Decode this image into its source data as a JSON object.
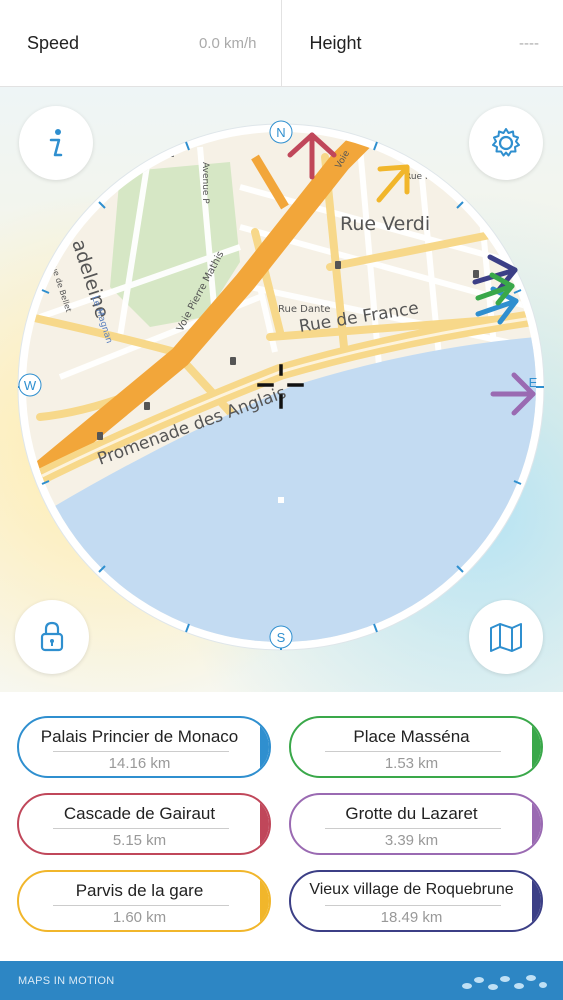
{
  "header": {
    "speed_label": "Speed",
    "speed_value": "0.0 km/h",
    "height_label": "Height",
    "height_value": "----"
  },
  "compass": {
    "north": "N",
    "east": "E",
    "south": "S",
    "west": "W"
  },
  "map_labels": {
    "rue_verdi": "Rue Verdi",
    "rue_de_france": "Rue de France",
    "promenade": "Promenade des Anglais",
    "madeleine": "adeleine",
    "voie_pierre_mathis": "Voie Pierre Mathis",
    "rue_dante": "Rue Dante",
    "rue_rossini": "Rue Rossini",
    "avenue": "Avenue P",
    "voie": "Voie",
    "magnan": "Le Magnan",
    "rue_de_bellet": "Rue de Bellet"
  },
  "buttons": {
    "info_icon": "info-icon",
    "settings_icon": "gear-icon",
    "lock_icon": "lock-icon",
    "map_icon": "folded-map-icon"
  },
  "destinations": [
    {
      "name": "Palais Princier de Monaco",
      "distance": "14.16 km",
      "color": "#2f8fcf"
    },
    {
      "name": "Place Masséna",
      "distance": "1.53 km",
      "color": "#3aa84a"
    },
    {
      "name": "Cascade de Gairaut",
      "distance": "5.15 km",
      "color": "#c0475a"
    },
    {
      "name": "Grotte du Lazaret",
      "distance": "3.39 km",
      "color": "#9a6ab2"
    },
    {
      "name": "Parvis de la gare",
      "distance": "1.60 km",
      "color": "#f1b62b"
    },
    {
      "name": "Vieux village de Roquebrune",
      "distance": "18.49 km",
      "color": "#3c3f86"
    }
  ],
  "footer": {
    "brand": "MAPS IN MOTION"
  },
  "colors": {
    "footer_bg": "#2d86c4",
    "sea": "#c3dbf2",
    "main_road": "#f2a63a",
    "pointer_red": "#c0475a",
    "pointer_yellow": "#f1b62b",
    "pointer_navy": "#3c3f86",
    "pointer_blue": "#2f8fcf",
    "pointer_purple": "#9a6ab2",
    "pointer_green": "#3aa84a"
  }
}
